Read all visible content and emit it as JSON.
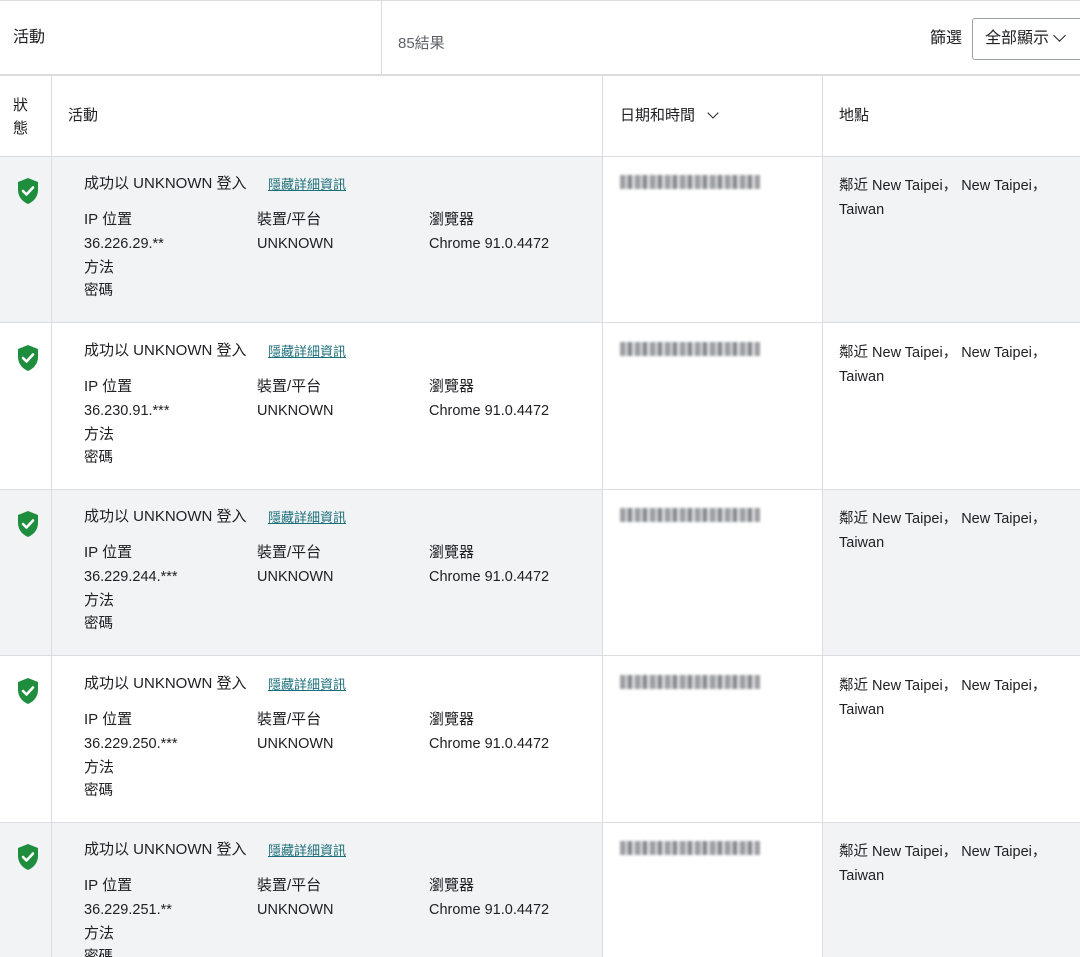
{
  "header": {
    "title": "活動",
    "result_count": "85結果",
    "filter_label": "篩選",
    "filter_value": "全部顯示"
  },
  "columns": {
    "status": "狀態",
    "activity": "活動",
    "datetime": "日期和時間",
    "location": "地點"
  },
  "colors": {
    "shield_green": "#1e8e3e",
    "link_teal": "#1b6f7a"
  },
  "rows": [
    {
      "title": "成功以 UNKNOWN 登入",
      "link": "隱藏詳細資訊",
      "ip_label": "IP 位置",
      "ip": "36.226.29.**",
      "device_label": "裝置/平台",
      "device": "UNKNOWN",
      "browser_label": "瀏覽器",
      "browser": "Chrome 91.0.4472",
      "method_label": "方法",
      "method": "密碼",
      "location": "鄰近 New Taipei， New Taipei， Taiwan"
    },
    {
      "title": "成功以 UNKNOWN 登入",
      "link": "隱藏詳細資訊",
      "ip_label": "IP 位置",
      "ip": "36.230.91.***",
      "device_label": "裝置/平台",
      "device": "UNKNOWN",
      "browser_label": "瀏覽器",
      "browser": "Chrome 91.0.4472",
      "method_label": "方法",
      "method": "密碼",
      "location": "鄰近 New Taipei， New Taipei， Taiwan"
    },
    {
      "title": "成功以 UNKNOWN 登入",
      "link": "隱藏詳細資訊",
      "ip_label": "IP 位置",
      "ip": "36.229.244.***",
      "device_label": "裝置/平台",
      "device": "UNKNOWN",
      "browser_label": "瀏覽器",
      "browser": "Chrome 91.0.4472",
      "method_label": "方法",
      "method": "密碼",
      "location": "鄰近 New Taipei， New Taipei， Taiwan"
    },
    {
      "title": "成功以 UNKNOWN 登入",
      "link": "隱藏詳細資訊",
      "ip_label": "IP 位置",
      "ip": "36.229.250.***",
      "device_label": "裝置/平台",
      "device": "UNKNOWN",
      "browser_label": "瀏覽器",
      "browser": "Chrome 91.0.4472",
      "method_label": "方法",
      "method": "密碼",
      "location": "鄰近 New Taipei， New Taipei， Taiwan"
    },
    {
      "title": "成功以 UNKNOWN 登入",
      "link": "隱藏詳細資訊",
      "ip_label": "IP 位置",
      "ip": "36.229.251.**",
      "device_label": "裝置/平台",
      "device": "UNKNOWN",
      "browser_label": "瀏覽器",
      "browser": "Chrome 91.0.4472",
      "method_label": "方法",
      "method": "密碼",
      "location": "鄰近 New Taipei， New Taipei， Taiwan"
    }
  ]
}
